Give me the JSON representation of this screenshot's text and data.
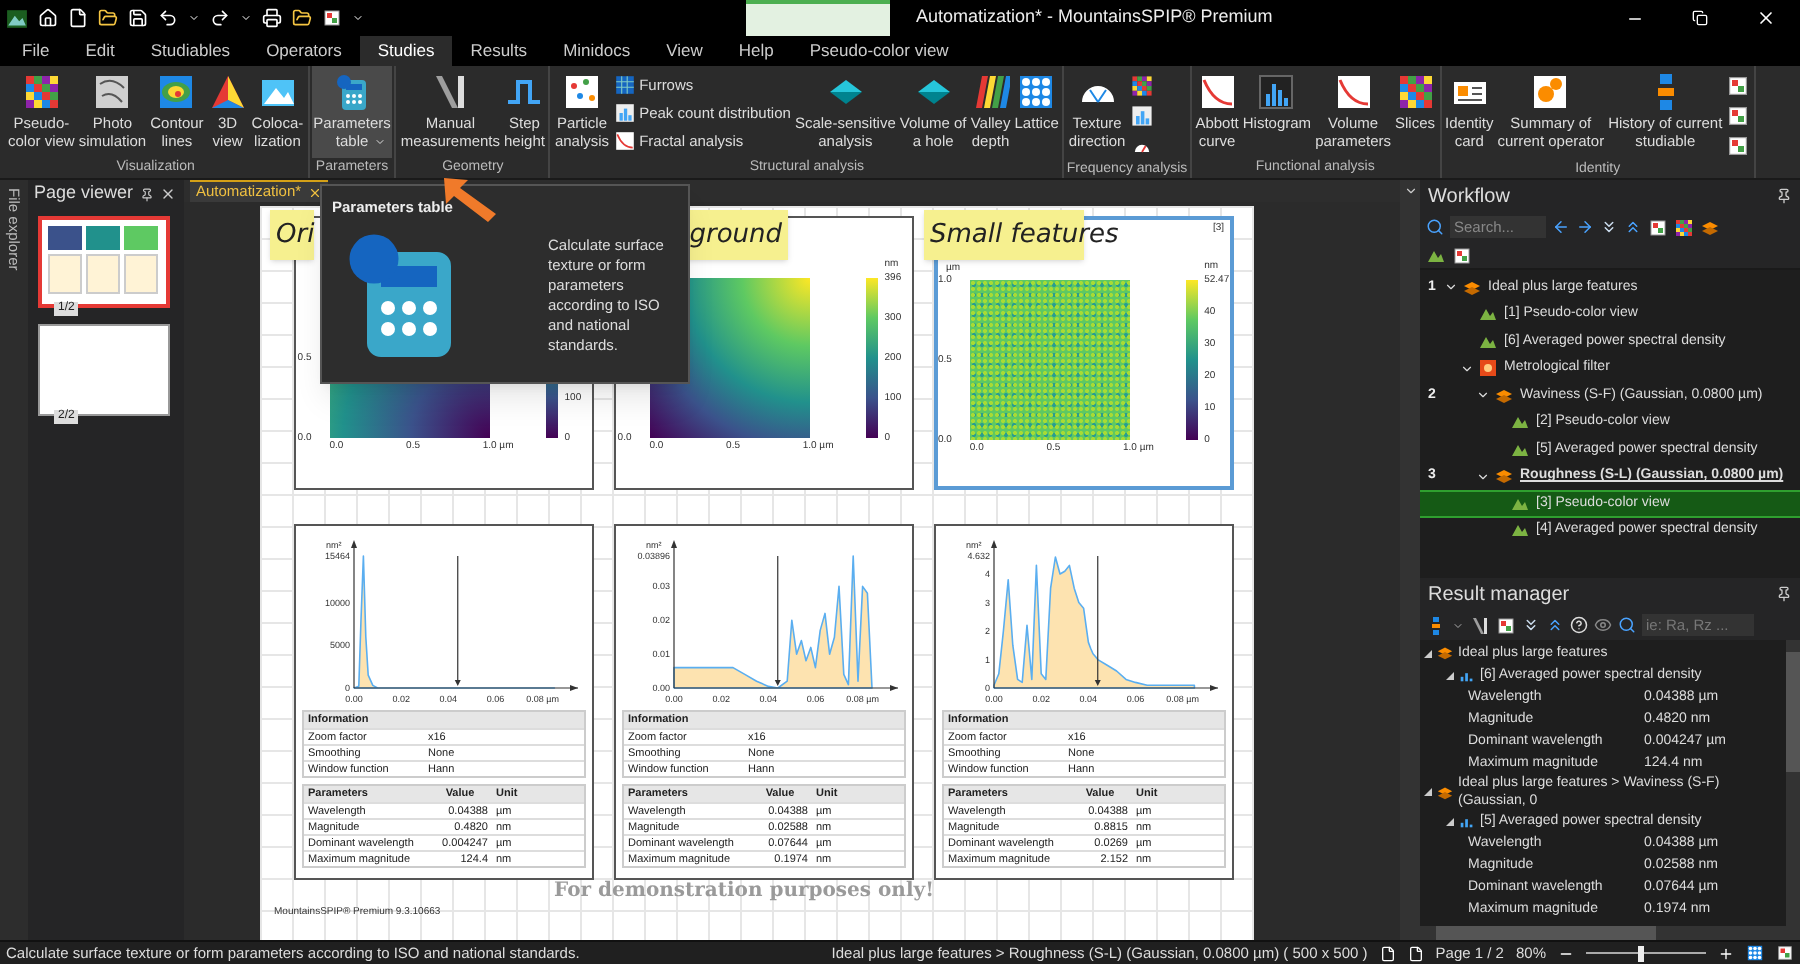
{
  "title_bar": {
    "title": "Automatization* - MountainsSPIP® Premium"
  },
  "menu": [
    {
      "label": "File",
      "selected": false
    },
    {
      "label": "Edit",
      "selected": false
    },
    {
      "label": "Studiables",
      "selected": false
    },
    {
      "label": "Operators",
      "selected": false
    },
    {
      "label": "Studies",
      "selected": true
    },
    {
      "label": "Results",
      "selected": false
    },
    {
      "label": "Minidocs",
      "selected": false
    },
    {
      "label": "View",
      "selected": false
    },
    {
      "label": "Help",
      "selected": false
    },
    {
      "label": "Pseudo-color view",
      "selected": false
    }
  ],
  "ribbon": [
    {
      "label": "Visualization",
      "items": [
        {
          "kind": "large",
          "lines": [
            "Pseudo-",
            "color view"
          ],
          "highlighted": false,
          "dropdown": false
        },
        {
          "kind": "large",
          "lines": [
            "Photo",
            "simulation"
          ],
          "highlighted": false,
          "dropdown": false
        },
        {
          "kind": "large",
          "lines": [
            "Contour",
            "lines"
          ],
          "highlighted": false,
          "dropdown": false
        },
        {
          "kind": "large",
          "lines": [
            "3D",
            "view"
          ],
          "highlighted": false,
          "dropdown": false
        },
        {
          "kind": "large",
          "lines": [
            "Coloca-",
            "lization"
          ],
          "highlighted": false,
          "dropdown": false
        }
      ]
    },
    {
      "label": "Parameters",
      "items": [
        {
          "kind": "large",
          "lines": [
            "Parameters",
            "table"
          ],
          "highlighted": true,
          "dropdown": true
        }
      ]
    },
    {
      "label": "Geometry",
      "items": [
        {
          "kind": "large",
          "lines": [
            "Manual",
            "measurements"
          ],
          "highlighted": false,
          "dropdown": false
        },
        {
          "kind": "large",
          "lines": [
            "Step",
            "height"
          ],
          "highlighted": false,
          "dropdown": false
        }
      ]
    },
    {
      "label": "Structural analysis",
      "items": [
        {
          "kind": "large",
          "lines": [
            "Particle",
            "analysis"
          ],
          "highlighted": false,
          "dropdown": false
        },
        {
          "kind": "small",
          "lines": [
            "Furrows"
          ],
          "highlighted": false,
          "dropdown": false
        },
        {
          "kind": "small",
          "lines": [
            "Peak count distribution"
          ],
          "highlighted": false,
          "dropdown": false
        },
        {
          "kind": "small",
          "lines": [
            "Fractal analysis"
          ],
          "highlighted": false,
          "dropdown": false
        },
        {
          "kind": "large",
          "lines": [
            "Scale-sensitive",
            "analysis"
          ],
          "highlighted": false,
          "dropdown": false
        },
        {
          "kind": "large",
          "lines": [
            "Volume of",
            "a hole"
          ],
          "highlighted": false,
          "dropdown": false
        },
        {
          "kind": "large",
          "lines": [
            "Valley",
            "depth"
          ],
          "highlighted": false,
          "dropdown": false
        },
        {
          "kind": "large",
          "lines": [
            "Lattice"
          ],
          "highlighted": false,
          "dropdown": false
        }
      ]
    },
    {
      "label": "Frequency analysis",
      "items": [
        {
          "kind": "large",
          "lines": [
            "Texture",
            "direction"
          ],
          "highlighted": false,
          "dropdown": false
        },
        {
          "kind": "icon",
          "highlighted": false
        },
        {
          "kind": "icon",
          "highlighted": false
        },
        {
          "kind": "icon",
          "highlighted": false
        }
      ]
    },
    {
      "label": "Functional analysis",
      "items": [
        {
          "kind": "large",
          "lines": [
            "Abbott",
            "curve"
          ],
          "highlighted": false,
          "dropdown": false
        },
        {
          "kind": "large",
          "lines": [
            "Histogram"
          ],
          "highlighted": false,
          "dropdown": false
        },
        {
          "kind": "large",
          "lines": [
            "Volume",
            "parameters"
          ],
          "highlighted": false,
          "dropdown": false
        },
        {
          "kind": "large",
          "lines": [
            "Slices"
          ],
          "highlighted": false,
          "dropdown": false
        }
      ]
    },
    {
      "label": "Identity",
      "items": [
        {
          "kind": "large",
          "lines": [
            "Identity",
            "card"
          ],
          "highlighted": false,
          "dropdown": false
        },
        {
          "kind": "large",
          "lines": [
            "Summary of",
            "current operator"
          ],
          "highlighted": false,
          "dropdown": false
        },
        {
          "kind": "large",
          "lines": [
            "History of current",
            "studiable"
          ],
          "highlighted": false,
          "dropdown": false
        },
        {
          "kind": "icon",
          "highlighted": false
        },
        {
          "kind": "icon",
          "highlighted": false
        },
        {
          "kind": "icon",
          "highlighted": false
        }
      ]
    }
  ],
  "tooltip": {
    "title": "Parameters table",
    "text": "Calculate surface texture or form parameters according to ISO and national standards."
  },
  "file_explorer": {
    "label": "File explorer"
  },
  "page_viewer": {
    "title": "Page viewer",
    "pages": [
      {
        "label": "1/2",
        "selected": true,
        "kind": "content"
      },
      {
        "label": "2/2",
        "selected": false,
        "kind": "blank"
      }
    ]
  },
  "document": {
    "tab": "Automatization*",
    "notes": [
      {
        "text": "Ori"
      },
      {
        "text": "ground"
      },
      {
        "text": "Small features"
      }
    ],
    "maps": [
      {
        "kind": "smooth",
        "selected": false,
        "y_ticks": [
          "0.5",
          "0.0"
        ],
        "x_ticks": [
          "0.0",
          "0.5",
          "1.0 µm"
        ],
        "colorbar_ticks": [
          "100",
          "0"
        ]
      },
      {
        "kind": "smooth",
        "selected": false,
        "y_ticks": [
          "0.0"
        ],
        "x_ticks": [
          "0.0",
          "0.5",
          "1.0 µm"
        ],
        "colorbar_unit": "nm",
        "colorbar_ticks": [
          "396",
          "300",
          "200",
          "100",
          "0"
        ]
      },
      {
        "kind": "noise",
        "selected": true,
        "index_label": "[3]",
        "y_unit": "µm",
        "y_ticks": [
          "1.0",
          "0.5",
          "0.0"
        ],
        "x_ticks": [
          "0.0",
          "0.5",
          "1.0 µm"
        ],
        "colorbar_unit": "nm",
        "colorbar_ticks": [
          "52.47",
          "40",
          "30",
          "20",
          "10",
          "0"
        ]
      }
    ],
    "spectra": [
      {
        "chart_data": {
          "type": "area",
          "ylabel": "nm²",
          "x": [
            0,
            0.002,
            0.003,
            0.004,
            0.005,
            0.006,
            0.008,
            0.01,
            0.02,
            0.03,
            0.04,
            0.05,
            0.06,
            0.07,
            0.08,
            0.085
          ],
          "series": [
            {
              "color": "#fde3b0",
              "values": [
                0,
                200,
                8000,
                15464,
                6000,
                1500,
                300,
                0,
                0,
                0,
                0,
                0,
                0,
                0,
                0,
                0
              ]
            }
          ],
          "xlim": [
            0,
            0.095
          ],
          "ylim": [
            0,
            15464
          ],
          "xticks": [
            {
              "value": 0,
              "label": "0.00"
            },
            {
              "value": 0.02,
              "label": "0.02"
            },
            {
              "value": 0.04,
              "label": "0.04"
            },
            {
              "value": 0.06,
              "label": "0.06"
            },
            {
              "value": 0.08,
              "label": "0.08 µm"
            }
          ],
          "yticks": [
            0,
            5000,
            10000,
            15464
          ],
          "ref_lines": [
            {
              "axis": "x",
              "value": 0.044
            }
          ]
        },
        "info": {
          "header": "Information",
          "rows": [
            [
              "Zoom factor",
              "x16"
            ],
            [
              "Smoothing",
              "None"
            ],
            [
              "Window function",
              "Hann"
            ]
          ]
        },
        "params": {
          "headers": [
            "Parameters",
            "Value",
            "Unit"
          ],
          "rows": [
            [
              "Wavelength",
              "0.04388",
              "µm"
            ],
            [
              "Magnitude",
              "0.4820",
              "nm"
            ],
            [
              "Dominant wavelength",
              "0.004247",
              "µm"
            ],
            [
              "Maximum magnitude",
              "124.4",
              "nm"
            ]
          ]
        }
      },
      {
        "chart_data": {
          "type": "area",
          "ylabel": "nm²",
          "x": [
            0,
            0.005,
            0.01,
            0.015,
            0.02,
            0.025,
            0.03,
            0.035,
            0.04,
            0.044,
            0.048,
            0.05,
            0.052,
            0.054,
            0.056,
            0.058,
            0.06,
            0.062,
            0.064,
            0.066,
            0.068,
            0.07,
            0.072,
            0.074,
            0.076,
            0.078,
            0.08,
            0.082,
            0.084
          ],
          "series": [
            {
              "color": "#fde3b0",
              "values": [
                0.006,
                0.006,
                0.006,
                0.006,
                0.006,
                0.006,
                0.004,
                0.002,
                0.0005,
                0,
                0.002,
                0.02,
                0.01,
                0.014,
                0.008,
                0.012,
                0.006,
                0.017,
                0.022,
                0.01,
                0.015,
                0.03,
                0.004,
                0.001,
                0.03896,
                0.002,
                0.03,
                0.028,
                0
              ]
            }
          ],
          "xlim": [
            0,
            0.095
          ],
          "ylim": [
            0,
            0.03896
          ],
          "xticks": [
            {
              "value": 0,
              "label": "0.00"
            },
            {
              "value": 0.02,
              "label": "0.02"
            },
            {
              "value": 0.04,
              "label": "0.04"
            },
            {
              "value": 0.06,
              "label": "0.06"
            },
            {
              "value": 0.08,
              "label": "0.08 µm"
            }
          ],
          "yticks": [
            {
              "value": 0,
              "label": "0.00"
            },
            {
              "value": 0.01,
              "label": "0.01"
            },
            {
              "value": 0.02,
              "label": "0.02"
            },
            {
              "value": 0.03,
              "label": "0.03"
            },
            {
              "value": 0.03896,
              "label": "0.03896"
            }
          ],
          "ref_lines": [
            {
              "axis": "x",
              "value": 0.044
            }
          ]
        },
        "info": {
          "header": "Information",
          "rows": [
            [
              "Zoom factor",
              "x16"
            ],
            [
              "Smoothing",
              "None"
            ],
            [
              "Window function",
              "Hann"
            ]
          ]
        },
        "params": {
          "headers": [
            "Parameters",
            "Value",
            "Unit"
          ],
          "rows": [
            [
              "Wavelength",
              "0.04388",
              "µm"
            ],
            [
              "Magnitude",
              "0.02588",
              "nm"
            ],
            [
              "Dominant wavelength",
              "0.07644",
              "µm"
            ],
            [
              "Maximum magnitude",
              "0.1974",
              "nm"
            ]
          ]
        }
      },
      {
        "chart_data": {
          "type": "area",
          "ylabel": "nm²",
          "x": [
            0,
            0.002,
            0.004,
            0.006,
            0.008,
            0.01,
            0.012,
            0.014,
            0.016,
            0.018,
            0.02,
            0.022,
            0.024,
            0.026,
            0.028,
            0.03,
            0.032,
            0.034,
            0.036,
            0.038,
            0.039,
            0.04,
            0.041,
            0.042,
            0.043,
            0.044,
            0.048,
            0.052,
            0.056,
            0.06,
            0.065,
            0.07,
            0.08,
            0.085
          ],
          "series": [
            {
              "color": "#fde3b0",
              "values": [
                0.1,
                0.5,
                2,
                3.8,
                1.5,
                0.3,
                0.2,
                2.2,
                0.3,
                4.3,
                0.5,
                0.3,
                3.5,
                4.6,
                4,
                4.1,
                4.3,
                3.5,
                3,
                2.8,
                2.2,
                1.6,
                1.4,
                1.2,
                1.1,
                1,
                0.8,
                0.6,
                0.3,
                0.2,
                0.1,
                0.1,
                0.1,
                0.1
              ]
            }
          ],
          "xlim": [
            0,
            0.095
          ],
          "ylim": [
            0,
            4.632
          ],
          "xticks": [
            {
              "value": 0,
              "label": "0.00"
            },
            {
              "value": 0.02,
              "label": "0.02"
            },
            {
              "value": 0.04,
              "label": "0.04"
            },
            {
              "value": 0.06,
              "label": "0.06"
            },
            {
              "value": 0.08,
              "label": "0.08 µm"
            }
          ],
          "yticks": [
            0,
            1,
            2,
            3,
            4,
            4.632
          ],
          "ref_lines": [
            {
              "axis": "x",
              "value": 0.044
            }
          ]
        },
        "info": {
          "header": "Information",
          "rows": [
            [
              "Zoom factor",
              "x16"
            ],
            [
              "Smoothing",
              "None"
            ],
            [
              "Window function",
              "Hann"
            ]
          ]
        },
        "params": {
          "headers": [
            "Parameters",
            "Value",
            "Unit"
          ],
          "rows": [
            [
              "Wavelength",
              "0.04388",
              "µm"
            ],
            [
              "Magnitude",
              "0.8815",
              "nm"
            ],
            [
              "Dominant wavelength",
              "0.0269",
              "µm"
            ],
            [
              "Maximum magnitude",
              "2.152",
              "nm"
            ]
          ]
        }
      }
    ],
    "watermark": "For demonstration purposes only!",
    "footer": "MountainsSPIP® Premium 9.3.10663"
  },
  "workflow": {
    "title": "Workflow",
    "search_placeholder": "Search...",
    "tree": [
      {
        "number": "1",
        "label": "Ideal plus large features",
        "kind": "study",
        "selected": false,
        "current": false,
        "children": [
          {
            "label": "[1] Pseudo-color view",
            "kind": "view",
            "selected": false,
            "current": false
          },
          {
            "label": "[6] Averaged power spectral density",
            "kind": "view",
            "selected": false,
            "current": false
          },
          {
            "label": "Metrological filter",
            "kind": "filter",
            "selected": false,
            "current": false,
            "children": [
              {
                "number": "2",
                "label": "Waviness (S-F) (Gaussian, 0.0800 µm)",
                "kind": "study",
                "selected": false,
                "current": false,
                "children": [
                  {
                    "label": "[2] Pseudo-color view",
                    "kind": "view",
                    "selected": false,
                    "current": false
                  },
                  {
                    "label": "[5] Averaged power spectral density",
                    "kind": "view",
                    "selected": false,
                    "current": false
                  }
                ]
              },
              {
                "number": "3",
                "label": "Roughness (S-L) (Gaussian, 0.0800 µm)",
                "kind": "study",
                "selected": false,
                "current": true,
                "children": [
                  {
                    "label": "[3] Pseudo-color view",
                    "kind": "view",
                    "selected": true,
                    "current": false
                  },
                  {
                    "label": "[4] Averaged power spectral density",
                    "kind": "view",
                    "selected": false,
                    "current": false
                  }
                ]
              }
            ]
          }
        ]
      }
    ]
  },
  "result_manager": {
    "title": "Result manager",
    "search_placeholder": "ie: Ra, Rz ...",
    "tree": [
      {
        "kind": "study",
        "label": "Ideal plus large features",
        "children": [
          {
            "kind": "result",
            "label": "[6] Averaged power spectral density",
            "children": [
              {
                "kind": "parameter",
                "label": "Wavelength",
                "value": "0.04388 µm"
              },
              {
                "kind": "parameter",
                "label": "Magnitude",
                "value": "0.4820 nm"
              },
              {
                "kind": "parameter",
                "label": "Dominant wavelength",
                "value": "0.004247 µm"
              },
              {
                "kind": "parameter",
                "label": "Maximum magnitude",
                "value": "124.4 nm"
              }
            ]
          }
        ]
      },
      {
        "kind": "study",
        "label": "Ideal plus large features > Waviness (S-F) (Gaussian, 0",
        "children": [
          {
            "kind": "result",
            "label": "[5] Averaged power spectral density",
            "children": [
              {
                "kind": "parameter",
                "label": "Wavelength",
                "value": "0.04388 µm"
              },
              {
                "kind": "parameter",
                "label": "Magnitude",
                "value": "0.02588 nm"
              },
              {
                "kind": "parameter",
                "label": "Dominant wavelength",
                "value": "0.07644 µm"
              },
              {
                "kind": "parameter",
                "label": "Maximum magnitude",
                "value": "0.1974 nm"
              }
            ]
          }
        ]
      }
    ]
  },
  "status_bar": {
    "message": "Calculate surface texture or form parameters according to ISO and national standards.",
    "path": "Ideal plus large features > Roughness (S-L) (Gaussian, 0.0800 µm) ( 500 x 500 )",
    "page": "Page 1 / 2",
    "zoom": "80%",
    "zoom_slider": {
      "level": 0.45
    }
  }
}
